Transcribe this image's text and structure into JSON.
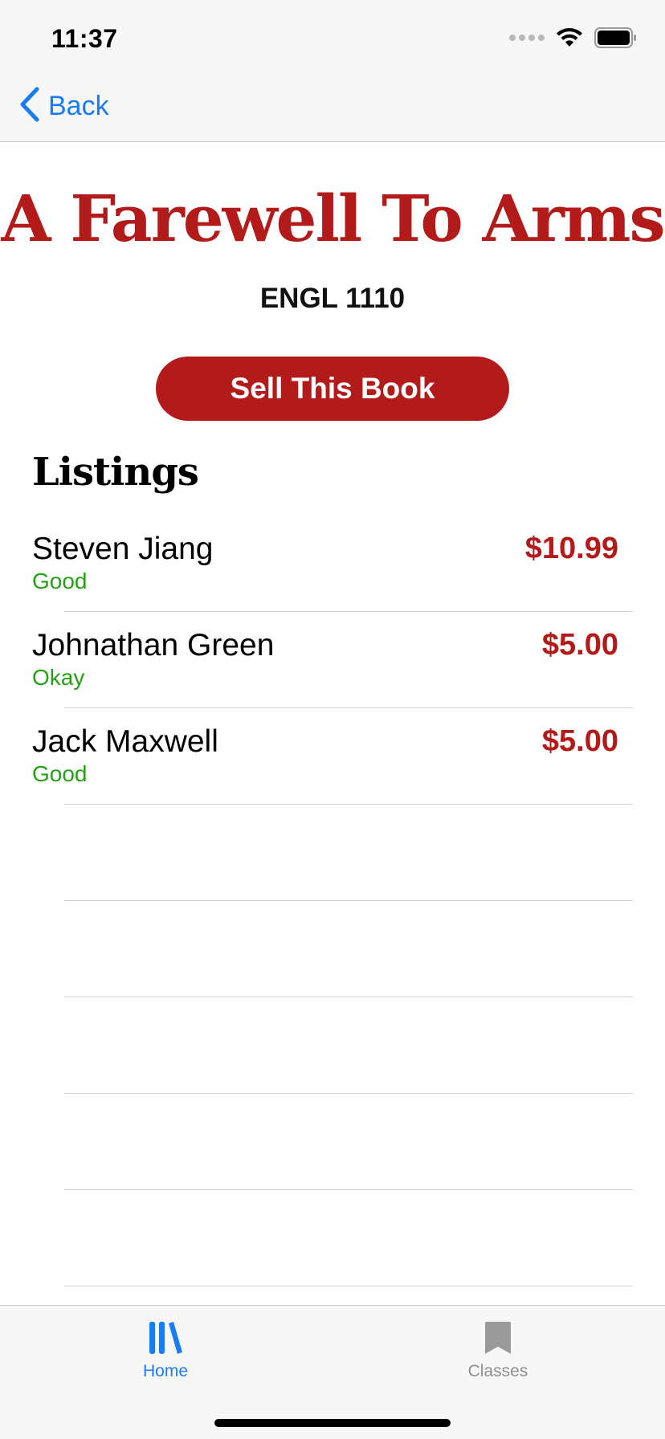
{
  "status_bar": {
    "time": "11:37"
  },
  "nav": {
    "back_label": "Back"
  },
  "book": {
    "title": "A Farewell To Arms",
    "course": "ENGL 1110"
  },
  "actions": {
    "sell_label": "Sell This Book"
  },
  "listings": {
    "heading": "Listings",
    "items": [
      {
        "seller": "Steven Jiang",
        "condition": "Good",
        "price": "$10.99"
      },
      {
        "seller": "Johnathan Green",
        "condition": "Okay",
        "price": "$5.00"
      },
      {
        "seller": "Jack Maxwell",
        "condition": "Good",
        "price": "$5.00"
      }
    ]
  },
  "tab_bar": {
    "tabs": [
      {
        "label": "Home",
        "icon": "library-icon",
        "selected": true
      },
      {
        "label": "Classes",
        "icon": "bookmark-icon",
        "selected": false
      }
    ]
  },
  "colors": {
    "accent": "#b31b1b",
    "link": "#1a7cf5",
    "condition": "#23a214"
  }
}
